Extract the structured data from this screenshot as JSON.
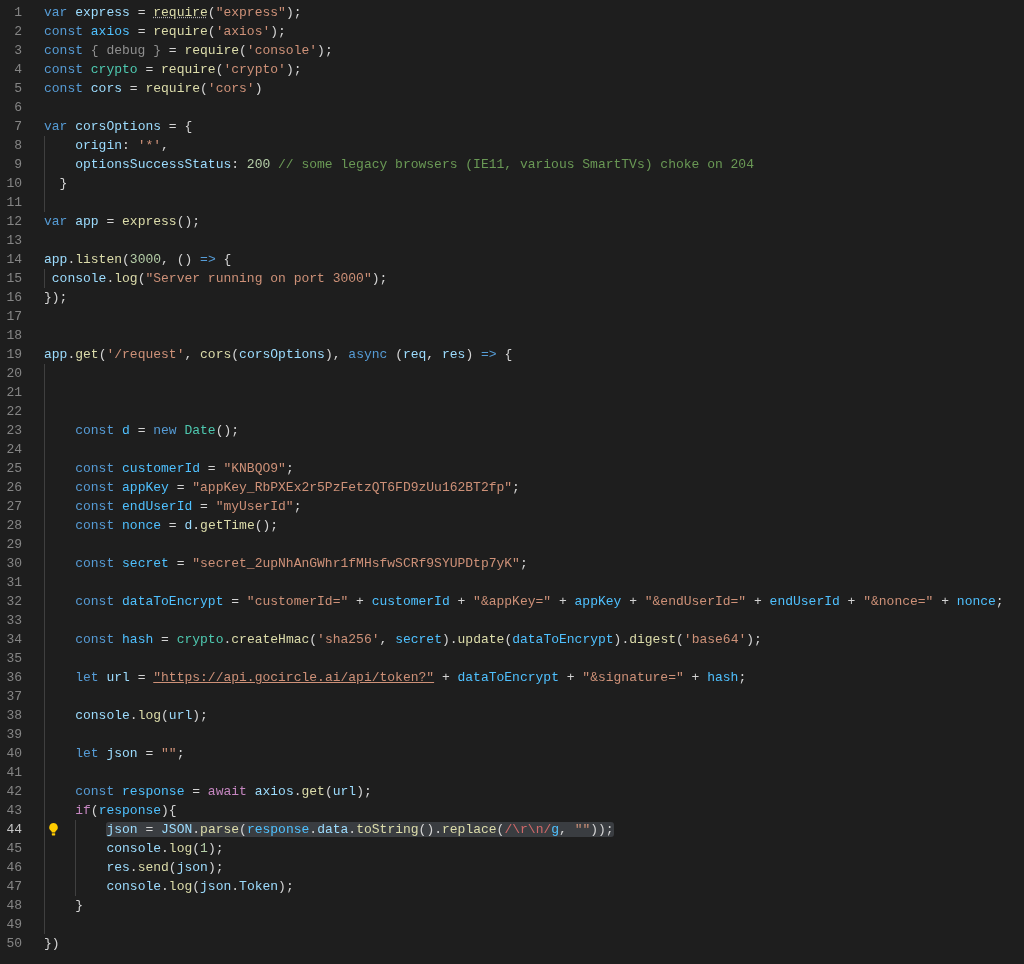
{
  "editor": {
    "lines": [
      {
        "number": "1",
        "tokens": [
          {
            "kind": "kw",
            "text": "var "
          },
          {
            "kind": "var",
            "text": "express"
          },
          {
            "kind": "p",
            "text": " = "
          },
          {
            "kind": "fn",
            "text": "require",
            "hint": true
          },
          {
            "kind": "p",
            "text": "("
          },
          {
            "kind": "str",
            "text": "\"express\""
          },
          {
            "kind": "p",
            "text": ");"
          }
        ]
      },
      {
        "number": "2",
        "tokens": [
          {
            "kind": "kw",
            "text": "const "
          },
          {
            "kind": "const",
            "text": "axios"
          },
          {
            "kind": "p",
            "text": " = "
          },
          {
            "kind": "fn",
            "text": "require"
          },
          {
            "kind": "p",
            "text": "("
          },
          {
            "kind": "str",
            "text": "'axios'"
          },
          {
            "kind": "p",
            "text": ");"
          }
        ]
      },
      {
        "number": "3",
        "tokens": [
          {
            "kind": "kw",
            "text": "const "
          },
          {
            "kind": "unused",
            "text": "{ debug }"
          },
          {
            "kind": "p",
            "text": " = "
          },
          {
            "kind": "fn",
            "text": "require"
          },
          {
            "kind": "p",
            "text": "("
          },
          {
            "kind": "str",
            "text": "'console'"
          },
          {
            "kind": "p",
            "text": ");"
          }
        ]
      },
      {
        "number": "4",
        "tokens": [
          {
            "kind": "kw",
            "text": "const "
          },
          {
            "kind": "type",
            "text": "crypto"
          },
          {
            "kind": "p",
            "text": " = "
          },
          {
            "kind": "fn",
            "text": "require"
          },
          {
            "kind": "p",
            "text": "("
          },
          {
            "kind": "str",
            "text": "'crypto'"
          },
          {
            "kind": "p",
            "text": ");"
          }
        ]
      },
      {
        "number": "5",
        "tokens": [
          {
            "kind": "kw",
            "text": "const "
          },
          {
            "kind": "var",
            "text": "cors"
          },
          {
            "kind": "p",
            "text": " = "
          },
          {
            "kind": "fn",
            "text": "require"
          },
          {
            "kind": "p",
            "text": "("
          },
          {
            "kind": "str",
            "text": "'cors'"
          },
          {
            "kind": "p",
            "text": ")"
          }
        ]
      },
      {
        "number": "6"
      },
      {
        "number": "7",
        "tokens": [
          {
            "kind": "kw",
            "text": "var "
          },
          {
            "kind": "var",
            "text": "corsOptions"
          },
          {
            "kind": "p",
            "text": " = {"
          }
        ]
      },
      {
        "number": "8",
        "tokens": [
          {
            "kind": "var",
            "text": "    origin"
          },
          {
            "kind": "p",
            "text": ": "
          },
          {
            "kind": "str",
            "text": "'*'"
          },
          {
            "kind": "p",
            "text": ","
          }
        ]
      },
      {
        "number": "9",
        "tokens": [
          {
            "kind": "var",
            "text": "    optionsSuccessStatus"
          },
          {
            "kind": "p",
            "text": ": "
          },
          {
            "kind": "num",
            "text": "200"
          },
          {
            "kind": "cmt",
            "text": " // some legacy browsers (IE11, various SmartTVs) choke on 204"
          }
        ]
      },
      {
        "number": "10",
        "tokens": [
          {
            "kind": "p",
            "text": "  }"
          }
        ]
      },
      {
        "number": "11"
      },
      {
        "number": "12",
        "tokens": [
          {
            "kind": "kw",
            "text": "var "
          },
          {
            "kind": "var",
            "text": "app"
          },
          {
            "kind": "p",
            "text": " = "
          },
          {
            "kind": "fn",
            "text": "express"
          },
          {
            "kind": "p",
            "text": "();"
          }
        ]
      },
      {
        "number": "13"
      },
      {
        "number": "14",
        "tokens": [
          {
            "kind": "var",
            "text": "app"
          },
          {
            "kind": "p",
            "text": "."
          },
          {
            "kind": "fn",
            "text": "listen"
          },
          {
            "kind": "p",
            "text": "("
          },
          {
            "kind": "num",
            "text": "3000"
          },
          {
            "kind": "p",
            "text": ", () "
          },
          {
            "kind": "kw",
            "text": "=>"
          },
          {
            "kind": "p",
            "text": " {"
          }
        ]
      },
      {
        "number": "15",
        "tokens": [
          {
            "kind": "var",
            "text": " console"
          },
          {
            "kind": "p",
            "text": "."
          },
          {
            "kind": "fn",
            "text": "log"
          },
          {
            "kind": "p",
            "text": "("
          },
          {
            "kind": "str",
            "text": "\"Server running on port 3000\""
          },
          {
            "kind": "p",
            "text": ");"
          }
        ]
      },
      {
        "number": "16",
        "tokens": [
          {
            "kind": "p",
            "text": "});"
          }
        ]
      },
      {
        "number": "17"
      },
      {
        "number": "18"
      },
      {
        "number": "19",
        "tokens": [
          {
            "kind": "var",
            "text": "app"
          },
          {
            "kind": "p",
            "text": "."
          },
          {
            "kind": "fn",
            "text": "get"
          },
          {
            "kind": "p",
            "text": "("
          },
          {
            "kind": "str",
            "text": "'/request'"
          },
          {
            "kind": "p",
            "text": ", "
          },
          {
            "kind": "fn",
            "text": "cors"
          },
          {
            "kind": "p",
            "text": "("
          },
          {
            "kind": "var",
            "text": "corsOptions"
          },
          {
            "kind": "p",
            "text": "), "
          },
          {
            "kind": "kw",
            "text": "async"
          },
          {
            "kind": "p",
            "text": " ("
          },
          {
            "kind": "var",
            "text": "req"
          },
          {
            "kind": "p",
            "text": ", "
          },
          {
            "kind": "var",
            "text": "res"
          },
          {
            "kind": "p",
            "text": ") "
          },
          {
            "kind": "kw",
            "text": "=>"
          },
          {
            "kind": "p",
            "text": " {"
          }
        ]
      },
      {
        "number": "20"
      },
      {
        "number": "21"
      },
      {
        "number": "22"
      },
      {
        "number": "23",
        "tokens": [
          {
            "kind": "kw",
            "text": "    const "
          },
          {
            "kind": "const",
            "text": "d"
          },
          {
            "kind": "p",
            "text": " = "
          },
          {
            "kind": "kw",
            "text": "new "
          },
          {
            "kind": "type",
            "text": "Date"
          },
          {
            "kind": "p",
            "text": "();"
          }
        ]
      },
      {
        "number": "24"
      },
      {
        "number": "25",
        "tokens": [
          {
            "kind": "kw",
            "text": "    const "
          },
          {
            "kind": "const",
            "text": "customerId"
          },
          {
            "kind": "p",
            "text": " = "
          },
          {
            "kind": "str",
            "text": "\"KNBQO9\""
          },
          {
            "kind": "p",
            "text": ";"
          }
        ]
      },
      {
        "number": "26",
        "tokens": [
          {
            "kind": "kw",
            "text": "    const "
          },
          {
            "kind": "const",
            "text": "appKey"
          },
          {
            "kind": "p",
            "text": " = "
          },
          {
            "kind": "str",
            "text": "\"appKey_RbPXEx2r5PzFetzQT6FD9zUu162BT2fp\""
          },
          {
            "kind": "p",
            "text": ";"
          }
        ]
      },
      {
        "number": "27",
        "tokens": [
          {
            "kind": "kw",
            "text": "    const "
          },
          {
            "kind": "const",
            "text": "endUserId"
          },
          {
            "kind": "p",
            "text": " = "
          },
          {
            "kind": "str",
            "text": "\"myUserId\""
          },
          {
            "kind": "p",
            "text": ";"
          }
        ]
      },
      {
        "number": "28",
        "tokens": [
          {
            "kind": "kw",
            "text": "    const "
          },
          {
            "kind": "const",
            "text": "nonce"
          },
          {
            "kind": "p",
            "text": " = "
          },
          {
            "kind": "var",
            "text": "d"
          },
          {
            "kind": "p",
            "text": "."
          },
          {
            "kind": "fn",
            "text": "getTime"
          },
          {
            "kind": "p",
            "text": "();"
          }
        ]
      },
      {
        "number": "29"
      },
      {
        "number": "30",
        "tokens": [
          {
            "kind": "kw",
            "text": "    const "
          },
          {
            "kind": "const",
            "text": "secret"
          },
          {
            "kind": "p",
            "text": " = "
          },
          {
            "kind": "str",
            "text": "\"secret_2upNhAnGWhr1fMHsfwSCRf9SYUPDtp7yK\""
          },
          {
            "kind": "p",
            "text": ";"
          }
        ]
      },
      {
        "number": "31"
      },
      {
        "number": "32",
        "tokens": [
          {
            "kind": "kw",
            "text": "    const "
          },
          {
            "kind": "const",
            "text": "dataToEncrypt"
          },
          {
            "kind": "p",
            "text": " = "
          },
          {
            "kind": "str",
            "text": "\"customerId=\""
          },
          {
            "kind": "p",
            "text": " + "
          },
          {
            "kind": "const",
            "text": "customerId"
          },
          {
            "kind": "p",
            "text": " + "
          },
          {
            "kind": "str",
            "text": "\"&appKey=\""
          },
          {
            "kind": "p",
            "text": " + "
          },
          {
            "kind": "const",
            "text": "appKey"
          },
          {
            "kind": "p",
            "text": " + "
          },
          {
            "kind": "str",
            "text": "\"&endUserId=\""
          },
          {
            "kind": "p",
            "text": " + "
          },
          {
            "kind": "const",
            "text": "endUserId"
          },
          {
            "kind": "p",
            "text": " + "
          },
          {
            "kind": "str",
            "text": "\"&nonce=\""
          },
          {
            "kind": "p",
            "text": " + "
          },
          {
            "kind": "const",
            "text": "nonce"
          },
          {
            "kind": "p",
            "text": ";"
          }
        ]
      },
      {
        "number": "33"
      },
      {
        "number": "34",
        "tokens": [
          {
            "kind": "kw",
            "text": "    const "
          },
          {
            "kind": "const",
            "text": "hash"
          },
          {
            "kind": "p",
            "text": " = "
          },
          {
            "kind": "type",
            "text": "crypto"
          },
          {
            "kind": "p",
            "text": "."
          },
          {
            "kind": "fn",
            "text": "createHmac"
          },
          {
            "kind": "p",
            "text": "("
          },
          {
            "kind": "str",
            "text": "'sha256'"
          },
          {
            "kind": "p",
            "text": ", "
          },
          {
            "kind": "const",
            "text": "secret"
          },
          {
            "kind": "p",
            "text": ")."
          },
          {
            "kind": "fn",
            "text": "update"
          },
          {
            "kind": "p",
            "text": "("
          },
          {
            "kind": "const",
            "text": "dataToEncrypt"
          },
          {
            "kind": "p",
            "text": ")."
          },
          {
            "kind": "fn",
            "text": "digest"
          },
          {
            "kind": "p",
            "text": "("
          },
          {
            "kind": "str",
            "text": "'base64'"
          },
          {
            "kind": "p",
            "text": ");"
          }
        ]
      },
      {
        "number": "35"
      },
      {
        "number": "36",
        "tokens": [
          {
            "kind": "kw",
            "text": "    let "
          },
          {
            "kind": "var",
            "text": "url"
          },
          {
            "kind": "p",
            "text": " = "
          },
          {
            "kind": "link",
            "text": "\"https://api.gocircle.ai/api/token?\""
          },
          {
            "kind": "p",
            "text": " + "
          },
          {
            "kind": "const",
            "text": "dataToEncrypt"
          },
          {
            "kind": "p",
            "text": " + "
          },
          {
            "kind": "str",
            "text": "\"&signature=\""
          },
          {
            "kind": "p",
            "text": " + "
          },
          {
            "kind": "const",
            "text": "hash"
          },
          {
            "kind": "p",
            "text": ";"
          }
        ]
      },
      {
        "number": "37"
      },
      {
        "number": "38",
        "tokens": [
          {
            "kind": "var",
            "text": "    console"
          },
          {
            "kind": "p",
            "text": "."
          },
          {
            "kind": "fn",
            "text": "log"
          },
          {
            "kind": "p",
            "text": "("
          },
          {
            "kind": "var",
            "text": "url"
          },
          {
            "kind": "p",
            "text": ");"
          }
        ]
      },
      {
        "number": "39"
      },
      {
        "number": "40",
        "tokens": [
          {
            "kind": "kw",
            "text": "    let "
          },
          {
            "kind": "var",
            "text": "json"
          },
          {
            "kind": "p",
            "text": " = "
          },
          {
            "kind": "str",
            "text": "\"\""
          },
          {
            "kind": "p",
            "text": ";"
          }
        ]
      },
      {
        "number": "41"
      },
      {
        "number": "42",
        "tokens": [
          {
            "kind": "kw",
            "text": "    const "
          },
          {
            "kind": "const",
            "text": "response"
          },
          {
            "kind": "p",
            "text": " = "
          },
          {
            "kind": "ctl",
            "text": "await "
          },
          {
            "kind": "var",
            "text": "axios"
          },
          {
            "kind": "p",
            "text": "."
          },
          {
            "kind": "fn",
            "text": "get"
          },
          {
            "kind": "p",
            "text": "("
          },
          {
            "kind": "var",
            "text": "url"
          },
          {
            "kind": "p",
            "text": ");"
          }
        ]
      },
      {
        "number": "43",
        "tokens": [
          {
            "kind": "ctl",
            "text": "    if"
          },
          {
            "kind": "p",
            "text": "("
          },
          {
            "kind": "const",
            "text": "response"
          },
          {
            "kind": "p",
            "text": "){"
          }
        ]
      },
      {
        "number": "44",
        "current": true,
        "tokens": [
          {
            "kind": "var",
            "text": "        json"
          },
          {
            "kind": "p",
            "text": " = "
          },
          {
            "kind": "var",
            "text": "JSON"
          },
          {
            "kind": "p",
            "text": "."
          },
          {
            "kind": "fn",
            "text": "parse"
          },
          {
            "kind": "p",
            "text": "("
          },
          {
            "kind": "const",
            "text": "response"
          },
          {
            "kind": "p",
            "text": "."
          },
          {
            "kind": "var",
            "text": "data"
          },
          {
            "kind": "p",
            "text": "."
          },
          {
            "kind": "fn",
            "text": "toString"
          },
          {
            "kind": "p",
            "text": "()."
          },
          {
            "kind": "fn",
            "text": "replace"
          },
          {
            "kind": "p",
            "text": "("
          },
          {
            "kind": "regex",
            "text": "/\\r\\n/"
          },
          {
            "kind": "const",
            "text": "g"
          },
          {
            "kind": "p",
            "text": ", "
          },
          {
            "kind": "str",
            "text": "\"\""
          },
          {
            "kind": "p",
            "text": "));"
          }
        ]
      },
      {
        "number": "45",
        "tokens": [
          {
            "kind": "var",
            "text": "        console"
          },
          {
            "kind": "p",
            "text": "."
          },
          {
            "kind": "fn",
            "text": "log"
          },
          {
            "kind": "p",
            "text": "("
          },
          {
            "kind": "num",
            "text": "1"
          },
          {
            "kind": "p",
            "text": ");"
          }
        ]
      },
      {
        "number": "46",
        "tokens": [
          {
            "kind": "var",
            "text": "        res"
          },
          {
            "kind": "p",
            "text": "."
          },
          {
            "kind": "fn",
            "text": "send"
          },
          {
            "kind": "p",
            "text": "("
          },
          {
            "kind": "var",
            "text": "json"
          },
          {
            "kind": "p",
            "text": ");"
          }
        ]
      },
      {
        "number": "47",
        "tokens": [
          {
            "kind": "var",
            "text": "        console"
          },
          {
            "kind": "p",
            "text": "."
          },
          {
            "kind": "fn",
            "text": "log"
          },
          {
            "kind": "p",
            "text": "("
          },
          {
            "kind": "var",
            "text": "json"
          },
          {
            "kind": "p",
            "text": "."
          },
          {
            "kind": "var",
            "text": "Token"
          },
          {
            "kind": "p",
            "text": ");"
          }
        ]
      },
      {
        "number": "48",
        "tokens": [
          {
            "kind": "p",
            "text": "    }"
          }
        ]
      },
      {
        "number": "49"
      },
      {
        "number": "50",
        "tokens": [
          {
            "kind": "p",
            "text": "})"
          }
        ]
      }
    ]
  }
}
